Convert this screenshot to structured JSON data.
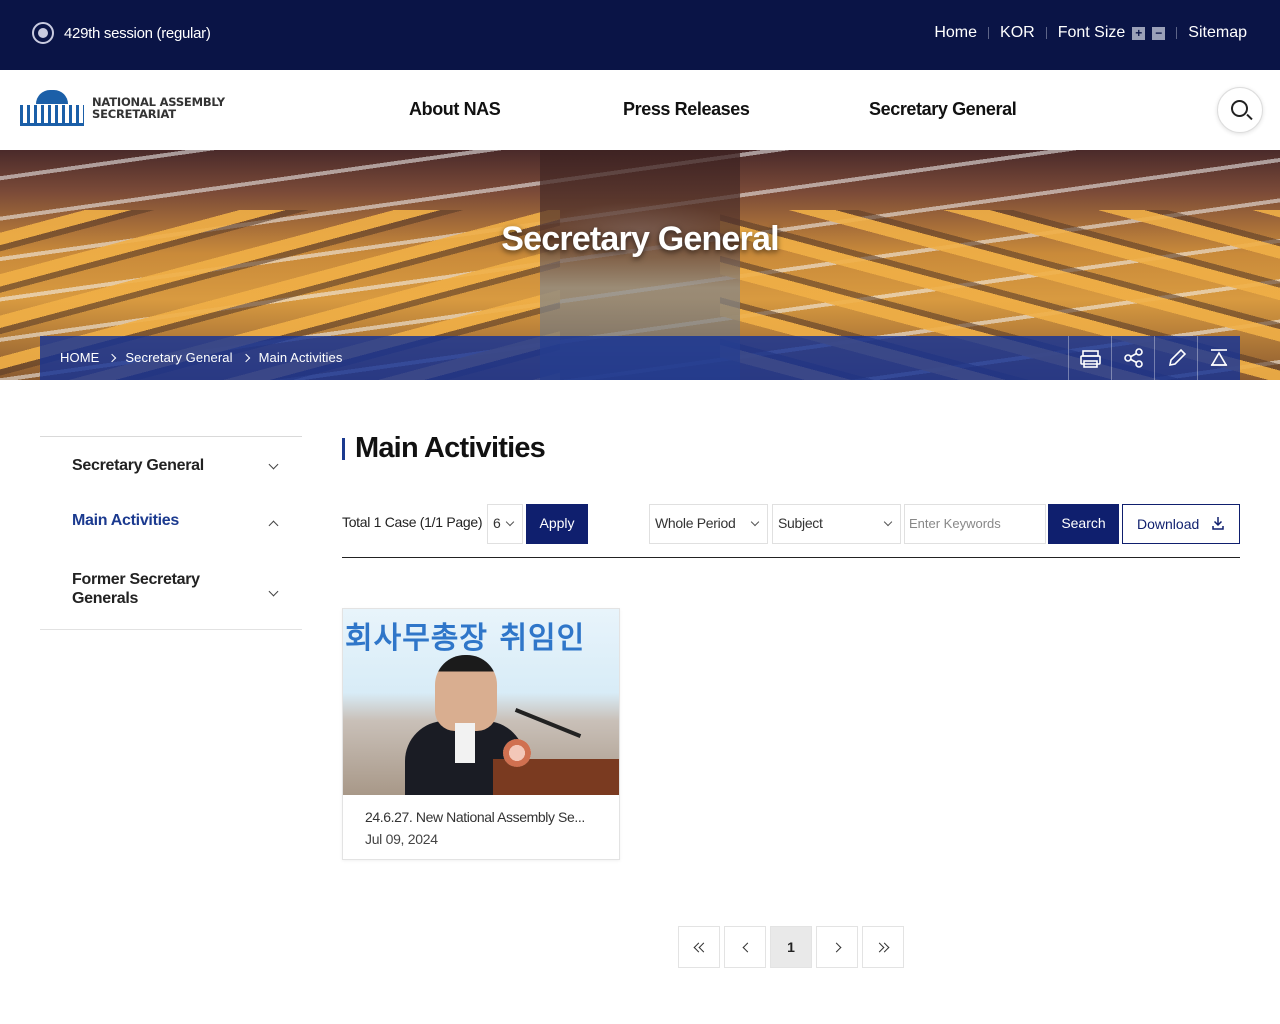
{
  "topbar": {
    "session": "429th session (regular)",
    "links": {
      "home": "Home",
      "lang": "KOR",
      "font_size": "Font Size",
      "sitemap": "Sitemap"
    },
    "font_plus": "+",
    "font_minus": "−"
  },
  "header": {
    "logo_line1": "NATIONAL ASSEMBLY",
    "logo_line2": "SECRETARIAT",
    "nav": [
      "About NAS",
      "Press Releases",
      "Secretary General"
    ]
  },
  "hero": {
    "title": "Secretary General",
    "breadcrumb": [
      "HOME",
      "Secretary General",
      "Main Activities"
    ],
    "tools": [
      "print-icon",
      "share-icon",
      "edit-icon",
      "scroll-top-icon"
    ]
  },
  "sidebar": {
    "items": [
      "Secretary General",
      "Main Activities",
      "Former Secretary Generals"
    ],
    "active_index": 1
  },
  "main": {
    "title": "Main Activities",
    "filter": {
      "total": "Total 1 Case (1/1 Page)",
      "per_page": "6",
      "apply": "Apply",
      "period": "Whole Period",
      "field": "Subject",
      "keyword_placeholder": "Enter Keywords",
      "search": "Search",
      "download": "Download"
    },
    "cards": [
      {
        "title": "24.6.27. New National Assembly Se...",
        "date": "Jul 09, 2024",
        "thumb_text": "회사무총장 취임인"
      }
    ]
  },
  "pagination": {
    "current": "1"
  },
  "colors": {
    "navy": "#0a1446",
    "accent": "#1b3a8f",
    "button": "#0f1f6e"
  }
}
